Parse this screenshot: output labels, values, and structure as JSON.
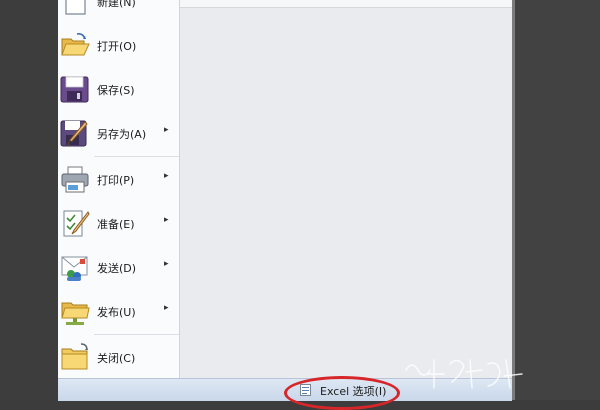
{
  "menu": {
    "items": [
      {
        "label": "新建(N)",
        "icon": "new-document-icon",
        "submenu": false
      },
      {
        "label": "打开(O)",
        "icon": "open-folder-icon",
        "submenu": false
      },
      {
        "label": "保存(S)",
        "icon": "save-disk-icon",
        "submenu": false
      },
      {
        "label": "另存为(A)",
        "icon": "save-as-icon",
        "submenu": true
      },
      {
        "label": "打印(P)",
        "icon": "printer-icon",
        "submenu": true
      },
      {
        "label": "准备(E)",
        "icon": "prepare-icon",
        "submenu": true
      },
      {
        "label": "发送(D)",
        "icon": "send-icon",
        "submenu": true
      },
      {
        "label": "发布(U)",
        "icon": "publish-icon",
        "submenu": true
      },
      {
        "label": "关闭(C)",
        "icon": "close-folder-icon",
        "submenu": false
      }
    ],
    "submenu_arrow": "▸"
  },
  "footer": {
    "options_label": "Excel 选项(I)",
    "options_icon": "options-icon"
  },
  "colors": {
    "menu_bg": "#fafbfd",
    "pane_bg": "#eaebef",
    "highlight": "#d7262a"
  }
}
